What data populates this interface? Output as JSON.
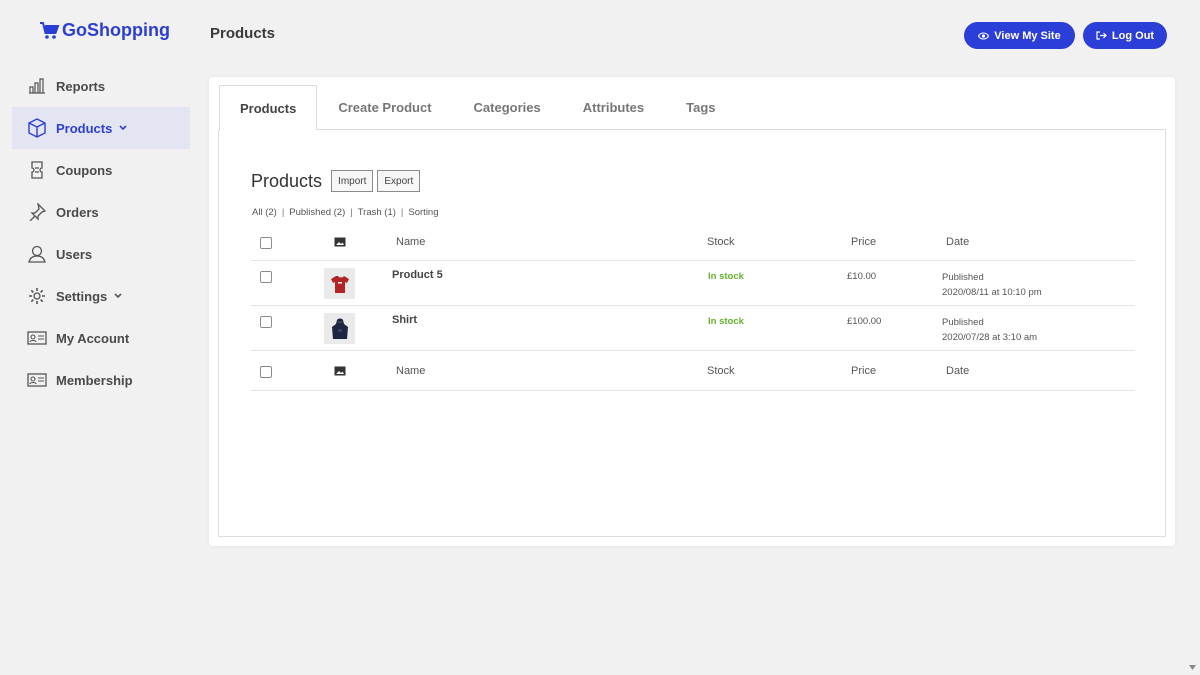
{
  "brand": {
    "name": "GoShopping",
    "accent": "#2c3ed8"
  },
  "sidebar": {
    "items": [
      {
        "label": "Reports",
        "icon": "bar-chart-icon"
      },
      {
        "label": "Products",
        "icon": "box-icon",
        "active": true,
        "has_submenu": true
      },
      {
        "label": "Coupons",
        "icon": "coupon-icon"
      },
      {
        "label": "Orders",
        "icon": "pin-icon"
      },
      {
        "label": "Users",
        "icon": "user-icon"
      },
      {
        "label": "Settings",
        "icon": "gear-icon",
        "has_submenu": true
      },
      {
        "label": "My Account",
        "icon": "id-card-icon"
      },
      {
        "label": "Membership",
        "icon": "id-card-icon"
      }
    ]
  },
  "header": {
    "title": "Products",
    "view_site_label": "View My Site",
    "logout_label": "Log Out"
  },
  "tabs": [
    "Products",
    "Create Product",
    "Categories",
    "Attributes",
    "Tags"
  ],
  "panel": {
    "heading": "Products",
    "import_label": "Import",
    "export_label": "Export",
    "filters": [
      "All (2)",
      "Published (2)",
      "Trash (1)",
      "Sorting"
    ]
  },
  "table": {
    "columns": {
      "name": "Name",
      "stock": "Stock",
      "price": "Price",
      "date": "Date"
    },
    "rows": [
      {
        "name": "Product 5",
        "stock": "In stock",
        "price": "£10.00",
        "status": "Published",
        "date": "2020/08/11 at 10:10 pm",
        "thumb": "tshirt-icon"
      },
      {
        "name": "Shirt",
        "stock": "In stock",
        "price": "£100.00",
        "status": "Published",
        "date": "2020/07/28 at 3:10 am",
        "thumb": "hoodie-icon"
      }
    ]
  },
  "colors": {
    "in_stock": "#65b32e",
    "background": "#f1f1f1"
  }
}
